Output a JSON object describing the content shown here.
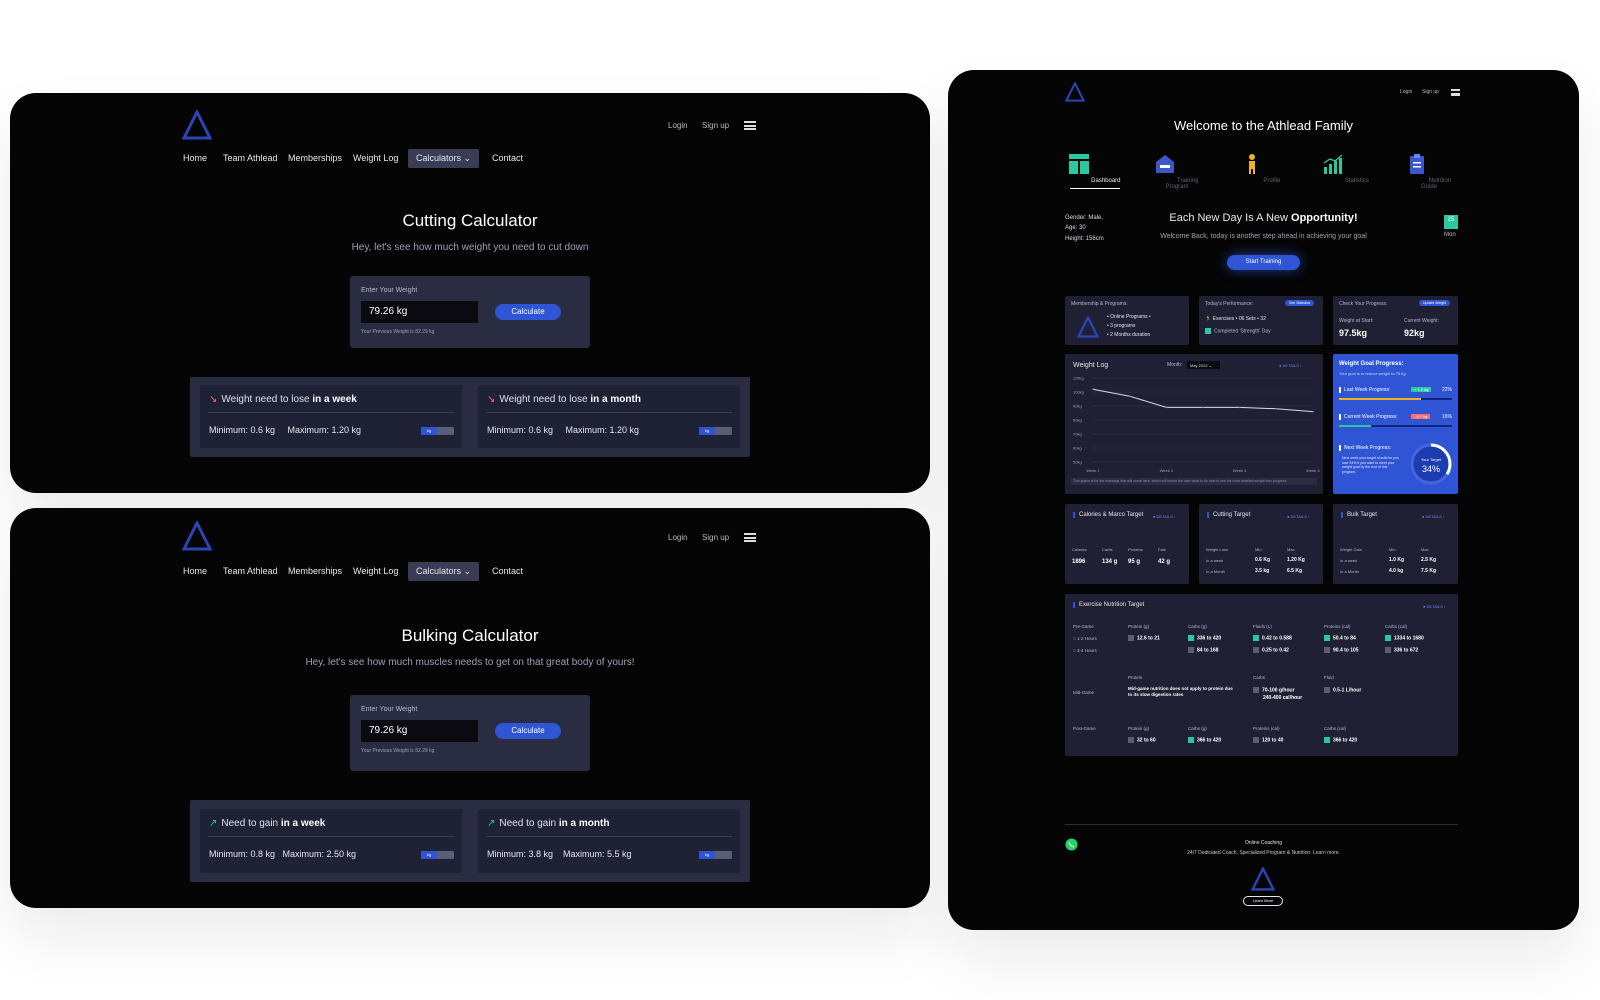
{
  "cutting": {
    "nav": {
      "items": [
        "Home",
        "Team Athlead",
        "Memberships",
        "Weight Log",
        "Calculators",
        "Contact"
      ],
      "login": "Login",
      "signup": "Sign up"
    },
    "title": "Cutting Calculator",
    "subtitle": "Hey, let's see how much weight you need to cut down",
    "input_label": "Enter Your Weight",
    "input_value": "79.26 kg",
    "button": "Calculate",
    "previous": "Your Previous Weight is 82.29 kg",
    "week_title_prefix": "Weight need to lose ",
    "week_title_bold": "in a week",
    "week_values": "Minimum: 0.6 kg     Maximum: 1.20 kg",
    "month_title_prefix": "Weight need to lose ",
    "month_title_bold": "in a month",
    "month_values": "Minimum: 0.6 kg     Maximum: 1.20 kg",
    "unit": "kg"
  },
  "bulking": {
    "nav": {
      "items": [
        "Home",
        "Team Athlead",
        "Memberships",
        "Weight Log",
        "Calculators",
        "Contact"
      ],
      "login": "Login",
      "signup": "Sign up"
    },
    "title": "Bulking Calculator",
    "subtitle": "Hey, let's see how much muscles needs to get on that great body of yours!",
    "input_label": "Enter Your Weight",
    "input_value": "79.26 kg",
    "button": "Calculate",
    "previous": "Your Previous Weight is 82.29 kg",
    "week_title_prefix": "Need to gain ",
    "week_title_bold": "in a week",
    "week_values": "Minimum: 0.8 kg   Maximum: 2.50 kg",
    "month_title_prefix": "Need to gain ",
    "month_title_bold": "in a month",
    "month_values": "Minimum: 3.8 kg    Maximum: 5.5 kg",
    "unit": "kg"
  },
  "dashboard": {
    "login": "Login",
    "signup": "Sign up",
    "welcome": "Welcome to the Athlead Family",
    "tabs": [
      "Dashboard",
      "Training Program",
      "Profile",
      "Statistics",
      "Nutrition Guide"
    ],
    "profile": [
      "Gender: Male,",
      "Age: 30",
      "Height: 156cm"
    ],
    "headline_prefix": "Each New Day Is A New ",
    "headline_bold": "Opportunity!",
    "welcome_back": "Welcome Back, today is another step ahead in achieving your goal",
    "date_day": "25",
    "date_weekday": "Mon",
    "start_training": "Start Training",
    "membership": {
      "title": "Membership & Programs:",
      "lines": [
        "• Online Programs •",
        "• 3 programs",
        "• 2 Months duration"
      ]
    },
    "performance": {
      "title": "Today's Performance:",
      "badge": "See Statistics",
      "line1": "Exercises  •  06    Sets  •  32",
      "line2": "Completed 'Strength' Day"
    },
    "progress": {
      "title": "Check Your Progress:",
      "badge": "Update Weight",
      "start_label": "Weight at Start:",
      "start_value": "97.5kg",
      "current_label": "Current Weight:",
      "current_value": "92kg"
    },
    "weight_log": {
      "title": "Weight Log",
      "month_label": "Month:",
      "month_value": "May 2022",
      "details": "DETAILS",
      "note": "This space is for the message that will come here, which will inform the user what to do next to see his more detailed weight loss progress."
    },
    "goal": {
      "title": "Weight Goal Progress:",
      "subtitle": "Your goal is to reduce weight to 75 kg",
      "last_week": "Last Week Progress:",
      "last_badge": "+ 1.2 kg",
      "last_pct": "22%",
      "current_week": "Current Week Progress:",
      "current_badge": "- 0.7 kg",
      "current_pct": "16%",
      "next_week": "Next Week Progress:",
      "next_text": "Next week your target should be you lose 34% if you want to meet your weight goal by the end of this program.",
      "target_label": "Your Target",
      "target_value": "34%",
      "last_fraction": 0.73,
      "current_fraction": 0.28,
      "target_fraction": 0.34
    },
    "calories": {
      "title": "Calories & Marco Target",
      "details": "DETAILS",
      "headers": [
        "Calories",
        "Carbs",
        "Proteins",
        "Fats"
      ],
      "values": [
        "1896",
        "134 g",
        "95 g",
        "42 g"
      ]
    },
    "cutting_target": {
      "title": "Cutting Target",
      "details": "DETAILS",
      "headers": [
        "Weight Loss",
        "Min.",
        "Max."
      ],
      "rows": [
        [
          "In a week",
          "0.6 Kg",
          "1.20 Kg"
        ],
        [
          "In a Month",
          "3.5 kg",
          "6.5 Kg"
        ]
      ]
    },
    "bulk_target": {
      "title": "Bulk Target",
      "details": "DETAILS",
      "headers": [
        "Weight Gain",
        "Min.",
        "Max."
      ],
      "rows": [
        [
          "In a week",
          "1.0 Kg",
          "2.5 Kg"
        ],
        [
          "In a Month",
          "4.0 kg",
          "7.5 Kg"
        ]
      ]
    },
    "exercise": {
      "title": "Exercise Nutrition Target",
      "details": "DETAILS",
      "pre_label": "Pre-Game",
      "pre_opts": [
        "1-2 Hours",
        "3-4 Hours"
      ],
      "pre_headers": [
        "Protein (g)",
        "Carbs (g)",
        "Fluids (L)",
        "Proteins (cal)",
        "Carbs (cal)"
      ],
      "pre_row1": [
        "12.6 to 21",
        "336 to 420",
        "0.42 to 0.588",
        "50.4 to 84",
        "1334 to 1680"
      ],
      "pre_row2": [
        "",
        "84 to 168",
        "0.25 to 0.42",
        "90.4 to 105",
        "336 to 672"
      ],
      "mid_label": "Mid-Game",
      "mid_headers": [
        "Protein",
        "Carbs",
        "Fluid"
      ],
      "mid_protein": "Mid-game nutrition does not apply to protein due to its slow digestion rates",
      "mid_carbs": "70-100 g/hour",
      "mid_carbs2": "240-400 cal/hour",
      "mid_fluid": "0.5-1 L/hour",
      "post_label": "Post-Game",
      "post_headers": [
        "Protein (g)",
        "Carbs (g)",
        "Proteins (cal)",
        "Carbs (cal)"
      ],
      "post_values": [
        "32 to 60",
        "366 to 420",
        "120 to 40",
        "366 to 420"
      ]
    },
    "footer": {
      "title": "Online Coaching",
      "subtitle": "24/7 Dedicated Coach, Specialized Program & Nutrition. Learn more.",
      "button": "Learn More"
    }
  },
  "chart_data": {
    "type": "line",
    "categories": [
      "Week 1",
      "Week 2",
      "Week 3",
      "Week 4"
    ],
    "y_ticks": [
      "110kg",
      "100kg",
      "90kg",
      "80kg",
      "70kg",
      "60kg",
      "50kg"
    ],
    "ylim": [
      50,
      110
    ],
    "x": [
      0,
      0.5,
      1,
      1.5,
      2,
      2.5,
      3
    ],
    "values": [
      102,
      97,
      89,
      89,
      89,
      88,
      86
    ],
    "grid": true
  }
}
